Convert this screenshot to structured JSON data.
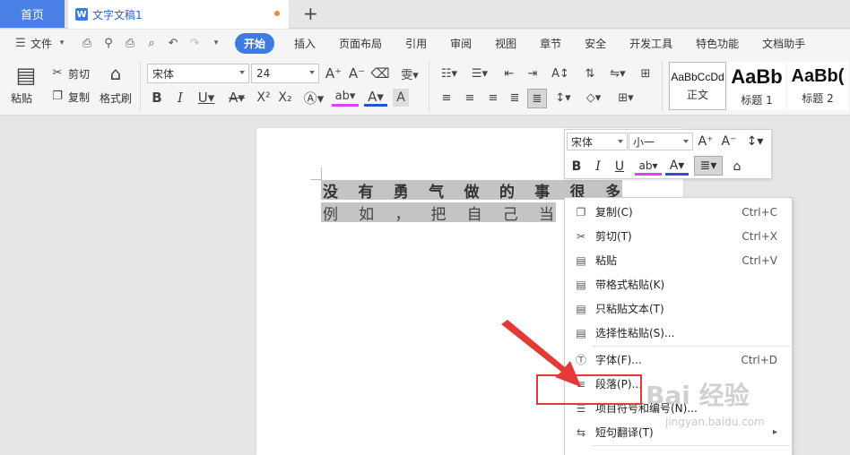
{
  "tabs": {
    "home": "首页",
    "doc_title": "文字文稿1",
    "doc_icon": "W",
    "new_tab": "+"
  },
  "menu": {
    "file": "文件",
    "items": [
      "开始",
      "插入",
      "页面布局",
      "引用",
      "审阅",
      "视图",
      "章节",
      "安全",
      "开发工具",
      "特色功能",
      "文档助手"
    ],
    "active_index": 0
  },
  "ribbon": {
    "paste": "粘贴",
    "cut": "剪切",
    "copy": "复制",
    "format_painter": "格式刷",
    "font_name": "宋体",
    "font_size": "24",
    "styles": [
      {
        "sample": "AaBbCcDd",
        "name": "正文"
      },
      {
        "sample": "AaBb",
        "name": "标题 1"
      },
      {
        "sample": "AaBb(",
        "name": "标题 2"
      }
    ]
  },
  "document": {
    "line1": [
      "没",
      "有",
      "勇",
      "气",
      "做",
      "的",
      "事",
      "很",
      "多"
    ],
    "line2": [
      "例",
      "如",
      "，",
      "把",
      "自",
      "己",
      "当"
    ]
  },
  "minibar": {
    "font_name": "宋体",
    "font_size": "小一"
  },
  "context_menu": [
    {
      "label": "复制(C)",
      "shortcut": "Ctrl+C",
      "icon": "copy-icon",
      "glyph": "❐"
    },
    {
      "label": "剪切(T)",
      "shortcut": "Ctrl+X",
      "icon": "scissors-icon",
      "glyph": "✂"
    },
    {
      "label": "粘贴",
      "shortcut": "Ctrl+V",
      "icon": "clipboard-icon",
      "glyph": "▤"
    },
    {
      "label": "带格式粘贴(K)",
      "shortcut": "",
      "icon": "paste-format-icon",
      "glyph": "▤"
    },
    {
      "label": "只粘贴文本(T)",
      "shortcut": "",
      "icon": "paste-text-icon",
      "glyph": "▤"
    },
    {
      "label": "选择性粘贴(S)...",
      "shortcut": "",
      "icon": "paste-special-icon",
      "glyph": "▤"
    },
    {
      "label": "字体(F)...",
      "shortcut": "Ctrl+D",
      "icon": "font-icon",
      "glyph": "Ⓣ"
    },
    {
      "label": "段落(P)...",
      "shortcut": "",
      "icon": "paragraph-icon",
      "glyph": "≡"
    },
    {
      "label": "项目符号和编号(N)...",
      "shortcut": "",
      "icon": "bullets-icon",
      "glyph": "☰"
    },
    {
      "label": "短句翻译(T)",
      "shortcut": "",
      "icon": "translate-icon",
      "glyph": "⇆"
    }
  ],
  "watermark": {
    "main": "Bai 经验",
    "sub": "jingyan.baidu.com"
  },
  "colors": {
    "accent": "#3c7ae6",
    "annotation": "#e53935"
  }
}
